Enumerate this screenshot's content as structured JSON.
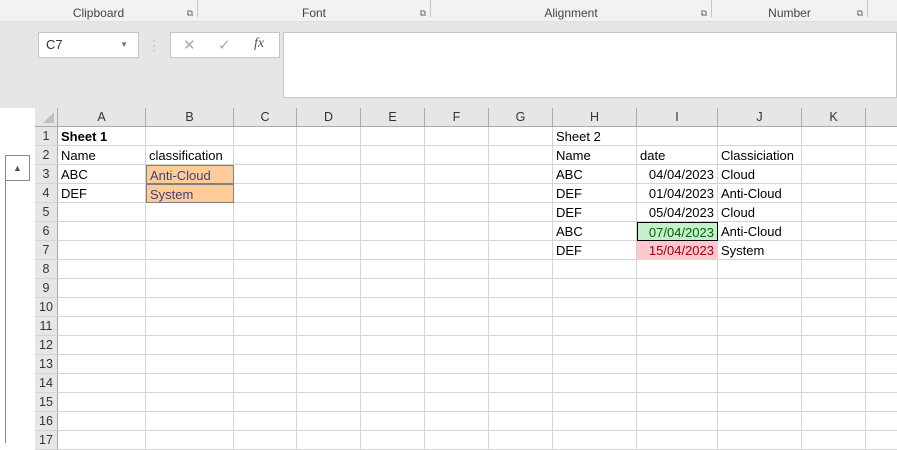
{
  "ribbon": {
    "groups": [
      "Clipboard",
      "Font",
      "Alignment",
      "Number"
    ]
  },
  "formula_bar": {
    "name_box": "C7",
    "cancel": "✕",
    "enter": "✓",
    "fx": "fx",
    "value": ""
  },
  "columns": [
    "A",
    "B",
    "C",
    "D",
    "E",
    "F",
    "G",
    "H",
    "I",
    "J",
    "K"
  ],
  "rows": [
    "1",
    "2",
    "3",
    "4",
    "5",
    "6",
    "7",
    "8",
    "9",
    "10",
    "11",
    "12",
    "13",
    "14",
    "15",
    "16",
    "17"
  ],
  "sheet1": {
    "title": "Sheet 1",
    "headers": [
      "Name",
      "classification"
    ],
    "rows": [
      [
        "ABC",
        "Anti-Cloud"
      ],
      [
        "DEF",
        "System"
      ]
    ]
  },
  "sheet2": {
    "title": "Sheet 2",
    "headers": [
      "Name",
      "date",
      "Classiciation"
    ],
    "rows": [
      [
        "ABC",
        "04/04/2023",
        "Cloud"
      ],
      [
        "DEF",
        "01/04/2023",
        "Anti-Cloud"
      ],
      [
        "DEF",
        "05/04/2023",
        "Cloud"
      ],
      [
        "ABC",
        "07/04/2023",
        "Anti-Cloud"
      ],
      [
        "DEF",
        "15/04/2023",
        "System"
      ]
    ]
  },
  "colors": {
    "input_fill": "#ffcc99",
    "good_fill": "#c6efce",
    "bad_fill": "#ffc7ce"
  }
}
